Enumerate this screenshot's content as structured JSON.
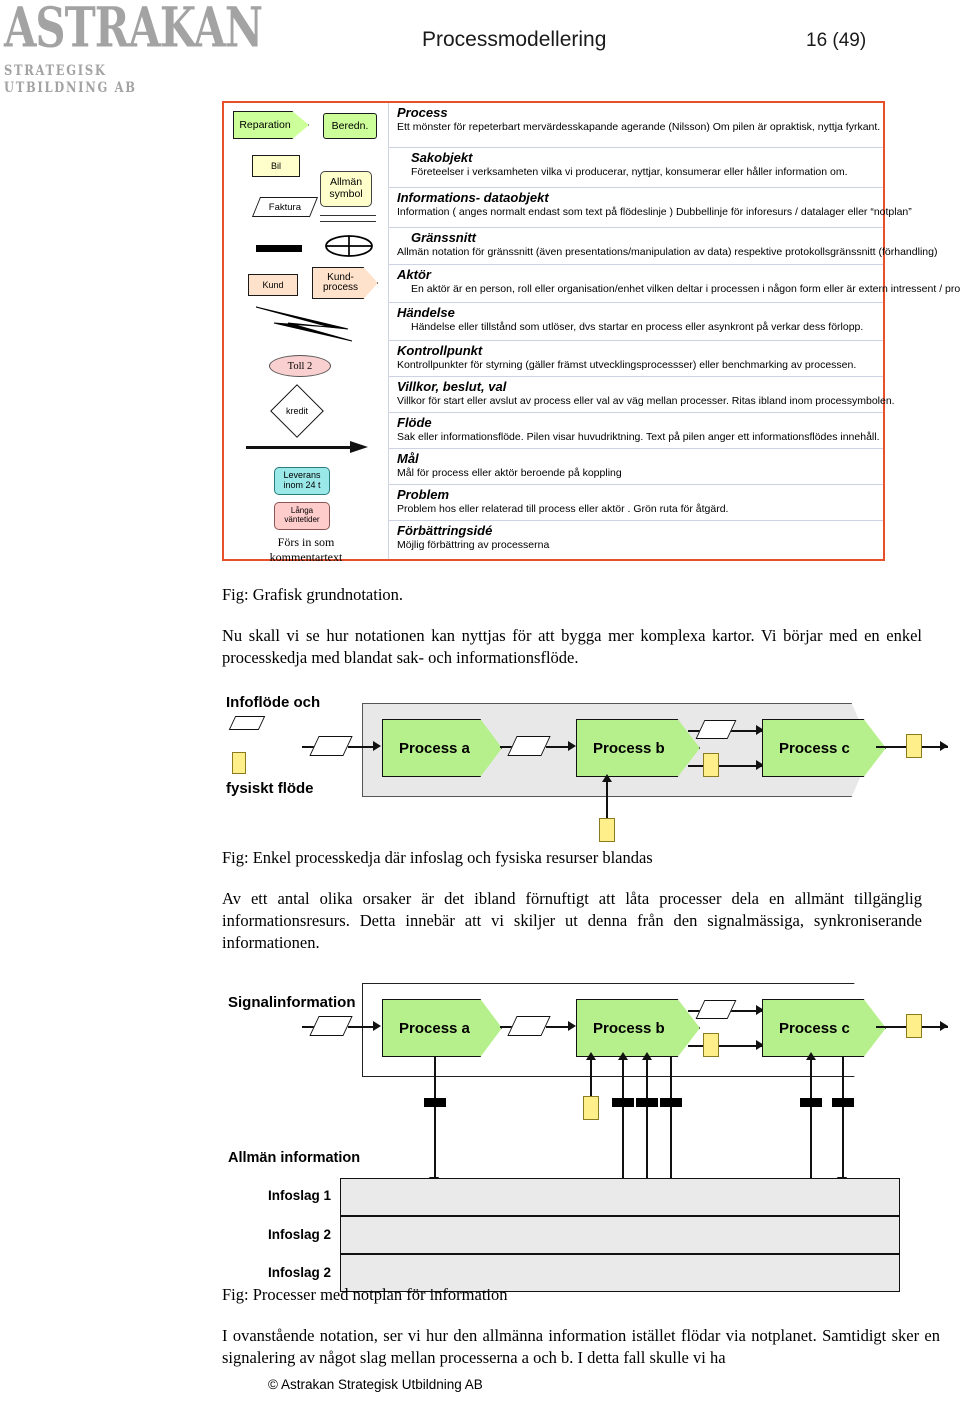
{
  "logo": {
    "word": "ASTRAKAN",
    "sub": "STRATEGISK UTBILDNING AB"
  },
  "header": {
    "title": "Processmodellering",
    "page": "16 (49)"
  },
  "legend": {
    "border_color": "#e8502a",
    "shapes": {
      "process_chevron": "Reparation",
      "process_box": "Beredn.",
      "sakobjekt_box": "Bil",
      "allman_symbol": "Allmän symbol",
      "faktura_para": "Faktura",
      "kund_box": "Kund",
      "kundprocess_chevron": "Kund-\nprocess",
      "kontrollpunkt_ellipse": "Toll 2",
      "villkor_diamond": "kredit",
      "mal_box": "Leverans inom 24 t",
      "problem_box": "Långa väntetider",
      "forbattring_note": "Förs in som kommentartext"
    },
    "colors": {
      "process_green": "#ccff99",
      "sakobjekt_yellow": "#ffffcc",
      "aktor_peach": "#ffe2cc",
      "kontrollpunkt_pink": "#f9cfcf",
      "mal_cyan": "#9ae8e8",
      "problem_pink": "#ffcccc"
    },
    "rows": [
      {
        "title": "Process",
        "desc": "Ett mönster för repeterbart mervärdesskapande agerande (Nilsson)  Om pilen är opraktisk, nyttja fyrkant."
      },
      {
        "title": "Sakobjekt",
        "desc": "Företeelser i verksamheten vilka vi producerar, nyttjar, konsumerar eller håller information om."
      },
      {
        "title": "Informations- dataobjekt",
        "desc": "Information ( anges normalt endast som text på flödeslinje ) Dubbellinje för inforesurs / datalager eller “notplan”"
      },
      {
        "title": "Gränssnitt",
        "desc": "Allmän notation för gränssnitt (även presentations/manipulation av data) respektive protokollsgränssnitt (förhandling)"
      },
      {
        "title": "Aktör",
        "desc": "En aktör är en  person, roll  eller organisation/enhet vilken deltar i processen i någon form eller är extern intressent / process."
      },
      {
        "title": "Händelse",
        "desc": "Händelse eller tillstånd som utlöser, dvs startar en process eller asynkront på verkar dess förlopp."
      },
      {
        "title": "Kontrollpunkt",
        "desc": "Kontrollpunkter för styrning  (gäller främst utvecklingsprocessser) eller benchmarking av processen."
      },
      {
        "title": "Villkor, beslut, val",
        "desc": "Villkor för start eller avslut av process eller val av väg mellan processer. Ritas ibland inom processymbolen."
      },
      {
        "title": "Flöde",
        "desc": "Sak eller informationsflöde. Pilen visar huvudriktning. Text på pilen anger ett informationsflödes innehåll."
      },
      {
        "title": "Mål",
        "desc": "Mål för process eller aktör beroende på koppling"
      },
      {
        "title": "Problem",
        "desc": "Problem hos eller relaterad till process eller aktör . Grön ruta för åtgärd."
      },
      {
        "title": "Förbättringsidé",
        "desc": "Möjlig förbättring av processerna"
      }
    ]
  },
  "captions": {
    "fig1": "Fig: Grafisk grundnotation.",
    "fig2": "Fig: Enkel processkedja där infoslag och fysiska resurser blandas",
    "fig3": "Fig: Processer med notplan för information"
  },
  "paragraphs": {
    "p1": "Nu skall vi se hur notationen kan nyttjas för att bygga mer komplexa kartor. Vi börjar med en enkel processkedja med blandat sak- och informationsflöde.",
    "p2": "Av ett antal olika orsaker är det ibland förnuftigt att låta processer dela en allmänt tillgänglig informationsresurs. Detta innebär att vi skiljer ut denna från den signalmässiga, synkroniserande informationen.",
    "p3": "I ovanstående notation, ser vi hur den allmänna information istället flödar via notplanet. Samtidigt sker en signalering av något slag mellan processerna a och b. I detta fall skulle vi ha"
  },
  "diagram1": {
    "label_top": "Infoflöde och",
    "label_bottom": "fysiskt flöde",
    "processes": [
      "Process a",
      "Process b",
      "Process c"
    ],
    "process_fill": "#b6f08c",
    "container_fill": "#e8e8e8",
    "physical_fill": "#ffef8a"
  },
  "diagram2": {
    "label": "Signalinformation",
    "processes": [
      "Process a",
      "Process b",
      "Process c"
    ],
    "notplan_title": "Allmän information",
    "notplan_rows": [
      "Infoslag 1",
      "Infoslag 2",
      "Infoslag 2"
    ],
    "notplan_fill": "#eaeaea"
  },
  "footer": "© Astrakan Strategisk Utbildning AB"
}
